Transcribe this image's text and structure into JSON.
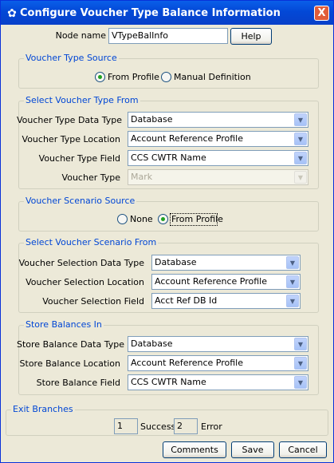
{
  "window": {
    "title": "Configure Voucher Type Balance Information",
    "close_label": "X"
  },
  "node": {
    "label": "Node name",
    "value": "VTypeBalInfo",
    "help_label": "Help"
  },
  "voucher_type_source": {
    "title": "Voucher Type Source",
    "options": [
      {
        "label": "From Profile",
        "selected": true
      },
      {
        "label": "Manual Definition",
        "selected": false
      }
    ]
  },
  "select_voucher_type_from": {
    "title": "Select Voucher Type From",
    "fields": [
      {
        "label": "Voucher Type Data Type",
        "value": "Database",
        "enabled": true
      },
      {
        "label": "Voucher Type Location",
        "value": "Account Reference Profile",
        "enabled": true
      },
      {
        "label": "Voucher Type Field",
        "value": "CCS CWTR Name",
        "enabled": true
      },
      {
        "label": "Voucher Type",
        "value": "Mark",
        "enabled": false
      }
    ]
  },
  "voucher_scenario_source": {
    "title": "Voucher Scenario Source",
    "options": [
      {
        "label": "None",
        "selected": false
      },
      {
        "label": "From Profile",
        "selected": true
      }
    ]
  },
  "select_voucher_scenario_from": {
    "title": "Select Voucher Scenario From",
    "fields": [
      {
        "label": "Voucher Selection Data Type",
        "value": "Database"
      },
      {
        "label": "Voucher Selection Location",
        "value": "Account Reference Profile"
      },
      {
        "label": "Voucher Selection Field",
        "value": "Acct Ref DB Id"
      }
    ]
  },
  "store_balances_in": {
    "title": "Store Balances In",
    "fields": [
      {
        "label": "Store Balance Data Type",
        "value": "Database"
      },
      {
        "label": "Store Balance Location",
        "value": "Account Reference Profile"
      },
      {
        "label": "Store Balance Field",
        "value": "CCS CWTR Name"
      }
    ]
  },
  "exit_branches": {
    "title": "Exit Branches",
    "branches": [
      {
        "number": "1",
        "name": "Success"
      },
      {
        "number": "2",
        "name": "Error"
      }
    ]
  },
  "footer": {
    "comments_label": "Comments",
    "save_label": "Save",
    "cancel_label": "Cancel"
  }
}
